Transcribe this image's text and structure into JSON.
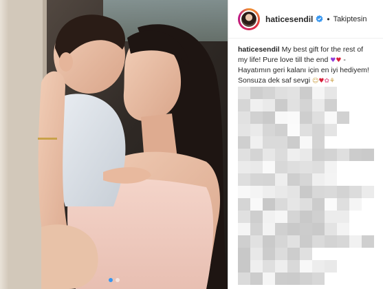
{
  "post": {
    "username": "haticesendil",
    "separator": "•",
    "follow_label": "Takiptesin"
  },
  "caption": {
    "user": "haticesendil",
    "text": "My best gift for the rest of my life! Pure love till the end",
    "text_tr": "- Hayatımın geri kalanı için en iyi hediyem! Sonsuza dek saf sevgi"
  },
  "colors": {
    "verified": "#3897f0",
    "active_dot": "#3897f0"
  },
  "carousel": {
    "count": 2,
    "active": 0
  }
}
